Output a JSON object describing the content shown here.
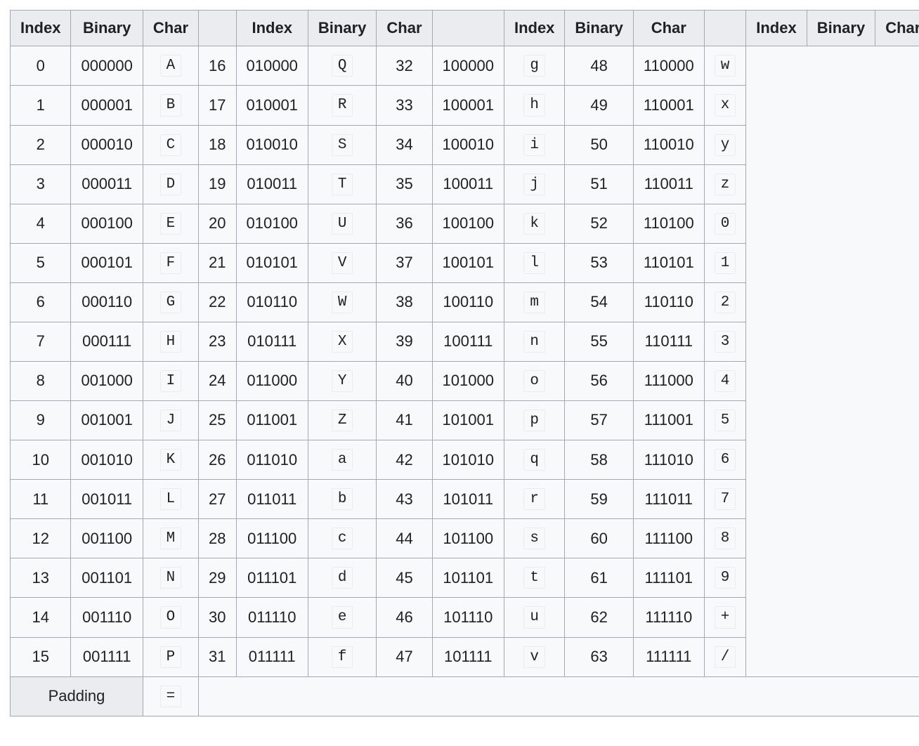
{
  "headers": {
    "index": "Index",
    "binary": "Binary",
    "char": "Char"
  },
  "footer": {
    "padding_label": "Padding",
    "padding_char": "="
  },
  "columns": [
    {
      "rows": [
        {
          "index": "0",
          "binary": "000000",
          "char": "A"
        },
        {
          "index": "1",
          "binary": "000001",
          "char": "B"
        },
        {
          "index": "2",
          "binary": "000010",
          "char": "C"
        },
        {
          "index": "3",
          "binary": "000011",
          "char": "D"
        },
        {
          "index": "4",
          "binary": "000100",
          "char": "E"
        },
        {
          "index": "5",
          "binary": "000101",
          "char": "F"
        },
        {
          "index": "6",
          "binary": "000110",
          "char": "G"
        },
        {
          "index": "7",
          "binary": "000111",
          "char": "H"
        },
        {
          "index": "8",
          "binary": "001000",
          "char": "I"
        },
        {
          "index": "9",
          "binary": "001001",
          "char": "J"
        },
        {
          "index": "10",
          "binary": "001010",
          "char": "K"
        },
        {
          "index": "11",
          "binary": "001011",
          "char": "L"
        },
        {
          "index": "12",
          "binary": "001100",
          "char": "M"
        },
        {
          "index": "13",
          "binary": "001101",
          "char": "N"
        },
        {
          "index": "14",
          "binary": "001110",
          "char": "O"
        },
        {
          "index": "15",
          "binary": "001111",
          "char": "P"
        }
      ]
    },
    {
      "rows": [
        {
          "index": "16",
          "binary": "010000",
          "char": "Q"
        },
        {
          "index": "17",
          "binary": "010001",
          "char": "R"
        },
        {
          "index": "18",
          "binary": "010010",
          "char": "S"
        },
        {
          "index": "19",
          "binary": "010011",
          "char": "T"
        },
        {
          "index": "20",
          "binary": "010100",
          "char": "U"
        },
        {
          "index": "21",
          "binary": "010101",
          "char": "V"
        },
        {
          "index": "22",
          "binary": "010110",
          "char": "W"
        },
        {
          "index": "23",
          "binary": "010111",
          "char": "X"
        },
        {
          "index": "24",
          "binary": "011000",
          "char": "Y"
        },
        {
          "index": "25",
          "binary": "011001",
          "char": "Z"
        },
        {
          "index": "26",
          "binary": "011010",
          "char": "a"
        },
        {
          "index": "27",
          "binary": "011011",
          "char": "b"
        },
        {
          "index": "28",
          "binary": "011100",
          "char": "c"
        },
        {
          "index": "29",
          "binary": "011101",
          "char": "d"
        },
        {
          "index": "30",
          "binary": "011110",
          "char": "e"
        },
        {
          "index": "31",
          "binary": "011111",
          "char": "f"
        }
      ]
    },
    {
      "rows": [
        {
          "index": "32",
          "binary": "100000",
          "char": "g"
        },
        {
          "index": "33",
          "binary": "100001",
          "char": "h"
        },
        {
          "index": "34",
          "binary": "100010",
          "char": "i"
        },
        {
          "index": "35",
          "binary": "100011",
          "char": "j"
        },
        {
          "index": "36",
          "binary": "100100",
          "char": "k"
        },
        {
          "index": "37",
          "binary": "100101",
          "char": "l"
        },
        {
          "index": "38",
          "binary": "100110",
          "char": "m"
        },
        {
          "index": "39",
          "binary": "100111",
          "char": "n"
        },
        {
          "index": "40",
          "binary": "101000",
          "char": "o"
        },
        {
          "index": "41",
          "binary": "101001",
          "char": "p"
        },
        {
          "index": "42",
          "binary": "101010",
          "char": "q"
        },
        {
          "index": "43",
          "binary": "101011",
          "char": "r"
        },
        {
          "index": "44",
          "binary": "101100",
          "char": "s"
        },
        {
          "index": "45",
          "binary": "101101",
          "char": "t"
        },
        {
          "index": "46",
          "binary": "101110",
          "char": "u"
        },
        {
          "index": "47",
          "binary": "101111",
          "char": "v"
        }
      ]
    },
    {
      "rows": [
        {
          "index": "48",
          "binary": "110000",
          "char": "w"
        },
        {
          "index": "49",
          "binary": "110001",
          "char": "x"
        },
        {
          "index": "50",
          "binary": "110010",
          "char": "y"
        },
        {
          "index": "51",
          "binary": "110011",
          "char": "z"
        },
        {
          "index": "52",
          "binary": "110100",
          "char": "0"
        },
        {
          "index": "53",
          "binary": "110101",
          "char": "1"
        },
        {
          "index": "54",
          "binary": "110110",
          "char": "2"
        },
        {
          "index": "55",
          "binary": "110111",
          "char": "3"
        },
        {
          "index": "56",
          "binary": "111000",
          "char": "4"
        },
        {
          "index": "57",
          "binary": "111001",
          "char": "5"
        },
        {
          "index": "58",
          "binary": "111010",
          "char": "6"
        },
        {
          "index": "59",
          "binary": "111011",
          "char": "7"
        },
        {
          "index": "60",
          "binary": "111100",
          "char": "8"
        },
        {
          "index": "61",
          "binary": "111101",
          "char": "9"
        },
        {
          "index": "62",
          "binary": "111110",
          "char": "+"
        },
        {
          "index": "63",
          "binary": "111111",
          "char": "/"
        }
      ]
    }
  ]
}
